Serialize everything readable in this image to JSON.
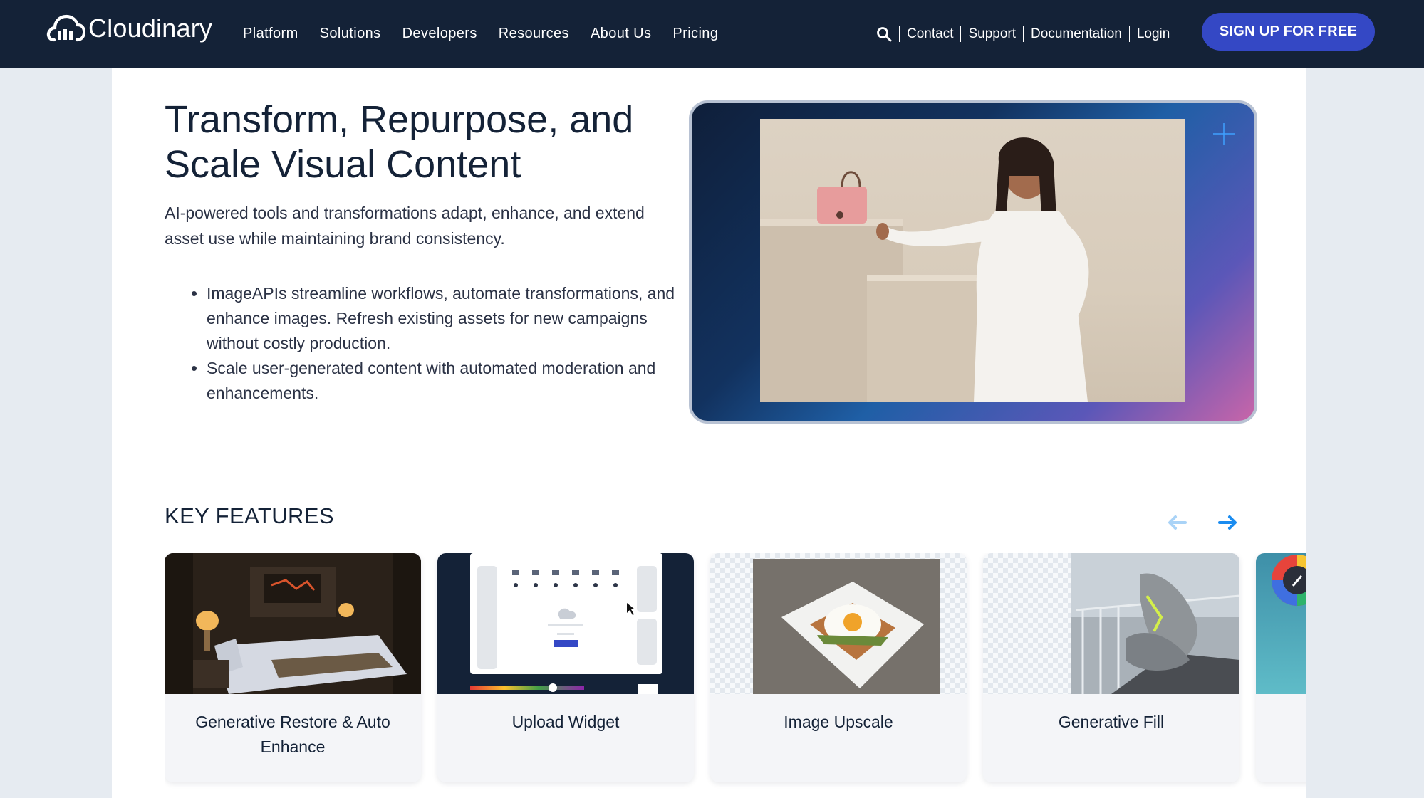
{
  "nav": {
    "logo_text": "Cloudinary",
    "menu": [
      {
        "label": "Platform"
      },
      {
        "label": "Solutions"
      },
      {
        "label": "Developers"
      },
      {
        "label": "Resources"
      },
      {
        "label": "About Us"
      },
      {
        "label": "Pricing"
      }
    ],
    "utility_links": [
      {
        "label": "Contact"
      },
      {
        "label": "Support"
      },
      {
        "label": "Documentation"
      },
      {
        "label": "Login"
      }
    ],
    "search_icon": "search-icon",
    "signup_label": "SIGN UP FOR FREE"
  },
  "hero": {
    "title": "Transform, Repurpose, and Scale Visual Content",
    "subtitle": "AI-powered tools and transformations  adapt, enhance, and extend asset use while maintaining brand consistency.",
    "bullets": [
      "ImageAPIs streamline workflows, automate transformations, and enhance images. Refresh existing assets for new campaigns without costly production.",
      "Scale user-generated content with automated moderation and enhancements."
    ]
  },
  "features": {
    "title": "KEY FEATURES",
    "prev_icon": "arrow-left-icon",
    "next_icon": "arrow-right-icon",
    "cards": [
      {
        "label": "Generative Restore & Auto Enhance"
      },
      {
        "label": "Upload Widget"
      },
      {
        "label": "Image Upscale"
      },
      {
        "label": "Generative Fill"
      },
      {
        "label": ""
      }
    ]
  },
  "colors": {
    "nav_bg": "#142237",
    "accent": "#3448c5",
    "page_bg": "#e6ebf1",
    "arrow_active": "#1a8cf0",
    "arrow_inactive": "#a9d3f7"
  }
}
